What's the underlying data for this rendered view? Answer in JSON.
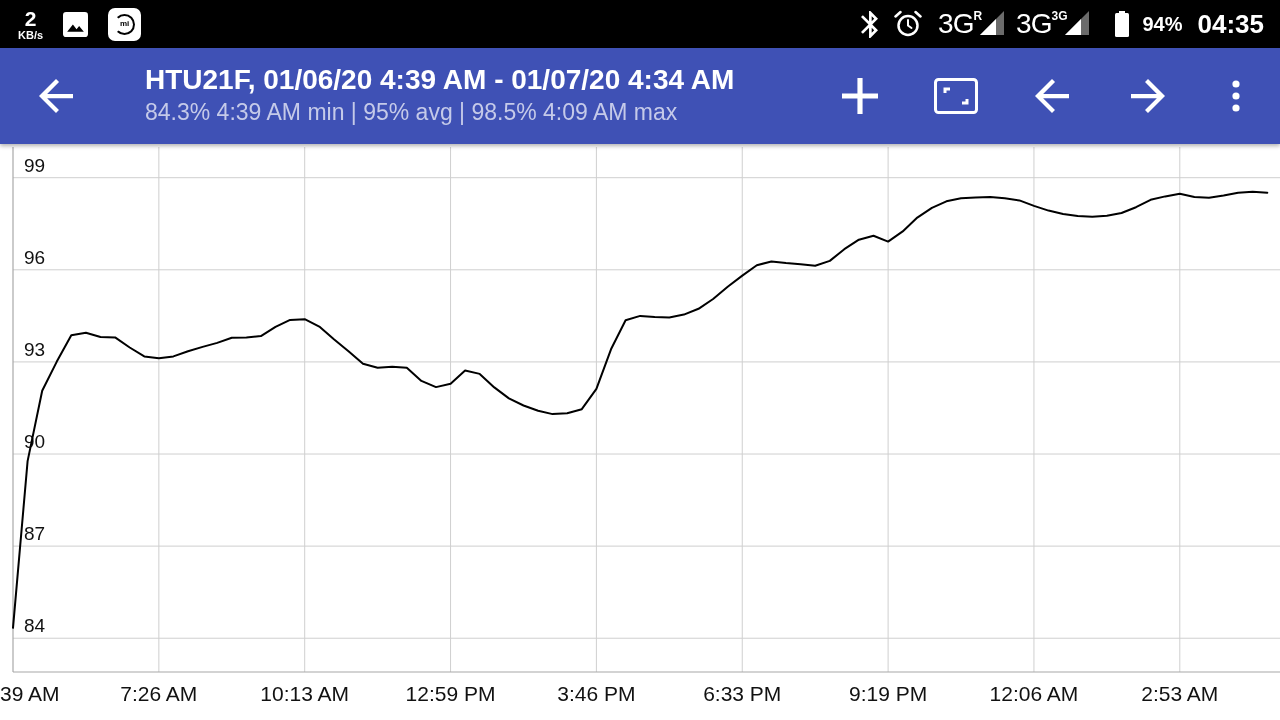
{
  "status_bar": {
    "network_speed": {
      "value": "2",
      "unit": "KB/s"
    },
    "notification_icons": [
      {
        "kind": "gallery"
      },
      {
        "kind": "app",
        "label": "mi"
      }
    ],
    "system_icons": [
      {
        "kind": "bluetooth"
      },
      {
        "kind": "alarm"
      }
    ],
    "networks": [
      {
        "type": "3G$^{R}$"
      },
      {
        "type": "3G$^{3G}$"
      }
    ],
    "battery_percent": "94%",
    "time": "04:35"
  },
  "app_bar": {
    "title": "HTU21F, 01/06/20 4:39 AM - 01/07/20 4:34 AM",
    "subtitle": "84.3% 4:39 AM min | 95% avg | 98.5% 4:09 AM max",
    "actions": [
      {
        "kind": "add"
      },
      {
        "kind": "fullscreen"
      },
      {
        "kind": "previous"
      },
      {
        "kind": "next"
      },
      {
        "kind": "more"
      }
    ]
  },
  "chart": {
    "cut_off_x_label": "39 AM",
    "chart_data": {
      "type": "line",
      "grid": true,
      "categories": [
        null,
        null,
        null,
        null,
        null,
        null,
        null,
        null,
        null,
        null,
        "7:26 AM",
        null,
        null,
        null,
        null,
        null,
        null,
        null,
        null,
        null,
        "10:13 AM",
        null,
        null,
        null,
        null,
        null,
        null,
        null,
        null,
        null,
        "12:59 PM",
        null,
        null,
        null,
        null,
        null,
        null,
        null,
        null,
        null,
        "3:46 PM",
        null,
        null,
        null,
        null,
        null,
        null,
        null,
        null,
        null,
        "6:33 PM",
        null,
        null,
        null,
        null,
        null,
        null,
        null,
        null,
        null,
        "9:19 PM",
        null,
        null,
        null,
        null,
        null,
        null,
        null,
        null,
        null,
        "12:06 AM",
        null,
        null,
        null,
        null,
        null,
        null,
        null,
        null,
        null,
        "2:53 AM",
        null,
        null,
        null,
        null,
        null,
        null
      ],
      "series": [
        {
          "color": "#000000",
          "values": [
            84.34,
            89.77,
            92.06,
            93.01,
            93.87,
            93.95,
            93.81,
            93.8,
            93.47,
            93.18,
            93.12,
            93.18,
            93.35,
            93.49,
            93.62,
            93.79,
            93.8,
            93.84,
            94.14,
            94.37,
            94.39,
            94.15,
            93.74,
            93.35,
            92.94,
            92.81,
            92.84,
            92.81,
            92.38,
            92.18,
            92.29,
            92.72,
            92.61,
            92.17,
            91.81,
            91.58,
            91.41,
            91.3,
            91.33,
            91.46,
            92.12,
            93.41,
            94.36,
            94.5,
            94.46,
            94.45,
            94.54,
            94.73,
            95.05,
            95.45,
            95.81,
            96.15,
            96.27,
            96.22,
            96.18,
            96.13,
            96.29,
            96.67,
            96.98,
            97.11,
            96.92,
            97.25,
            97.7,
            98.02,
            98.23,
            98.33,
            98.36,
            98.37,
            98.33,
            98.26,
            98.08,
            97.93,
            97.82,
            97.75,
            97.73,
            97.76,
            97.85,
            98.04,
            98.28,
            98.39,
            98.48,
            98.37,
            98.35,
            98.42,
            98.51,
            98.54,
            98.51
          ]
        }
      ],
      "ylim": [
        82.9,
        100
      ],
      "yticks": [
        84,
        87,
        90,
        93,
        96,
        99
      ]
    }
  }
}
